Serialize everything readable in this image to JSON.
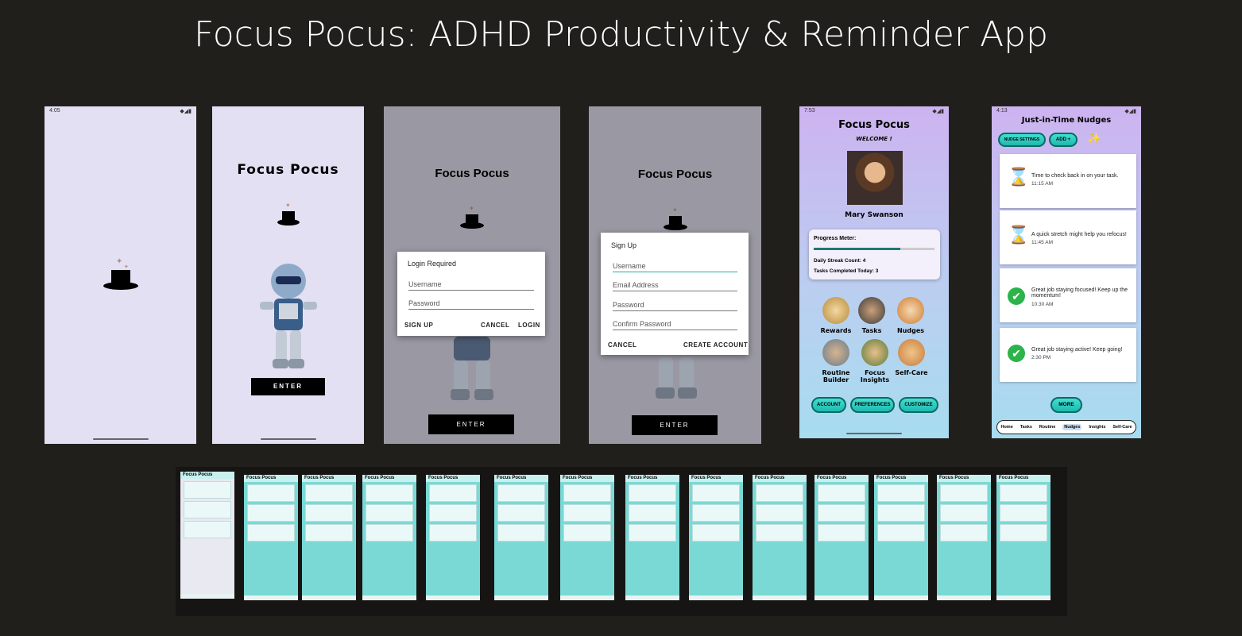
{
  "title": "Focus Pocus: ADHD Productivity & Reminder App",
  "phone1": {
    "time": "4:05",
    "status_icons": "◆◢▮"
  },
  "phone2": {
    "app_name": "Focus Pocus",
    "enter_label": "ENTER"
  },
  "phone3": {
    "app_name": "Focus Pocus",
    "dialog_title": "Login Required",
    "username_placeholder": "Username",
    "password_placeholder": "Password",
    "signup_label": "SIGN UP",
    "cancel_label": "CANCEL",
    "login_label": "LOGIN",
    "enter_label": "ENTER"
  },
  "phone4": {
    "app_name": "Focus Pocus",
    "dialog_title": "Sign Up",
    "username_placeholder": "Username",
    "email_placeholder": "Email Address",
    "password_placeholder": "Password",
    "confirm_placeholder": "Confirm Password",
    "cancel_label": "CANCEL",
    "create_label": "CREATE ACCOUNT",
    "enter_label": "ENTER"
  },
  "phone5": {
    "time": "7:53",
    "app_name": "Focus Pocus",
    "welcome": "WELCOME !",
    "user_name": "Mary Swanson",
    "progress_label": "Progress Meter:",
    "progress_fraction": 0.72,
    "streak": "Daily Streak Count: 4",
    "tasks_done": "Tasks Completed Today: 3",
    "features": [
      "Rewards",
      "Tasks",
      "Nudges",
      "Routine Builder",
      "Focus Insights",
      "Self-Care"
    ],
    "account_label": "ACCOUNT",
    "preferences_label": "PREFERENCES",
    "customize_label": "CUSTOMIZE"
  },
  "phone6": {
    "time": "4:13",
    "header": "Just-in-Time Nudges",
    "settings_label": "NUDGE SETTINGS",
    "add_label": "ADD +",
    "nudges": [
      {
        "icon": "hourglass-icon",
        "message": "Time to check back in on your task.",
        "time": "11:15 AM"
      },
      {
        "icon": "hourglass-icon",
        "message": "A quick stretch might help you refocus!",
        "time": "11:45 AM"
      },
      {
        "icon": "check-icon",
        "message": "Great job staying focused! Keep up the momentum!",
        "time": "10:30 AM"
      },
      {
        "icon": "check-icon",
        "message": "Great job staying active! Keep going!",
        "time": "2:30 PM"
      }
    ],
    "more_label": "MORE",
    "nav": [
      "Home",
      "Tasks",
      "Routine",
      "Nudges",
      "Insights",
      "Self-Care"
    ]
  },
  "thumbnails": [
    "Focus Pocus",
    "Focus Pocus",
    "Focus Pocus",
    "Focus Pocus",
    "Focus Pocus",
    "Focus Pocus",
    "Focus Pocus",
    "Focus Pocus",
    "Focus Pocus",
    "Focus Pocus",
    "Focus Pocus",
    "Focus Pocus",
    "Focus Pocus",
    "Focus Pocus"
  ],
  "colors": {
    "background": "#211f1c",
    "lavender": "#e2e0f2",
    "gray": "#9a99a3",
    "teal": "#40e0d0"
  }
}
